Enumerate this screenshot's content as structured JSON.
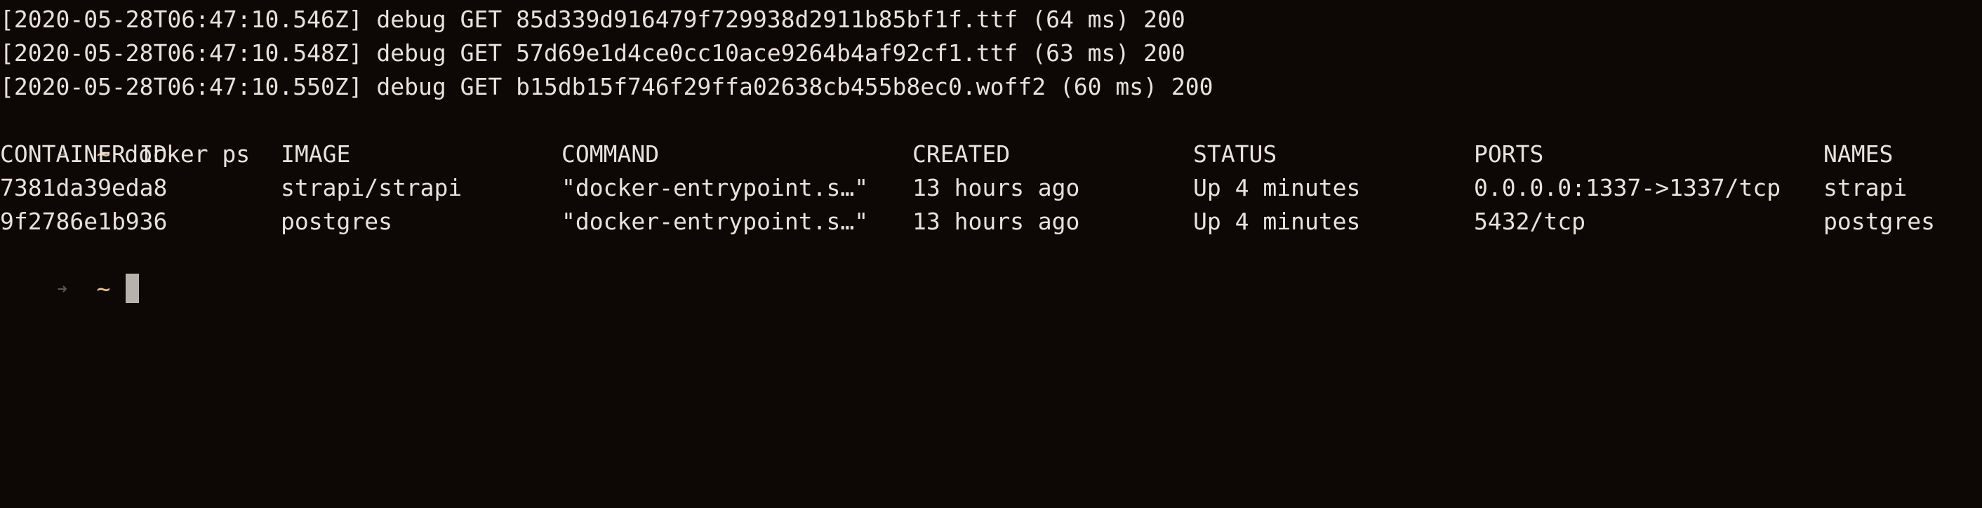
{
  "log_lines": [
    "[2020-05-28T06:47:10.546Z] debug GET 85d339d916479f729938d2911b85bf1f.ttf (64 ms) 200",
    "[2020-05-28T06:47:10.548Z] debug GET 57d69e1d4ce0cc10ace9264b4af92cf1.ttf (63 ms) 200",
    "[2020-05-28T06:47:10.550Z] debug GET b15db15f746f29ffa02638cb455b8ec0.woff2 (60 ms) 200"
  ],
  "prompt": {
    "arrow": "➜",
    "tilde": "~",
    "command": "docker ps"
  },
  "table": {
    "headers": {
      "container_id": "CONTAINER ID",
      "image": "IMAGE",
      "command": "COMMAND",
      "created": "CREATED",
      "status": "STATUS",
      "ports": "PORTS",
      "names": "NAMES"
    },
    "rows": [
      {
        "container_id": "7381da39eda8",
        "image": "strapi/strapi",
        "command": "\"docker-entrypoint.s…\"",
        "created": "13 hours ago",
        "status": "Up 4 minutes",
        "ports": "0.0.0.0:1337->1337/tcp",
        "names": "strapi"
      },
      {
        "container_id": "9f2786e1b936",
        "image": "postgres",
        "command": "\"docker-entrypoint.s…\"",
        "created": "13 hours ago",
        "status": "Up 4 minutes",
        "ports": "5432/tcp",
        "names": "postgres"
      }
    ]
  },
  "colors": {
    "background": "#0d0706",
    "text": "#e8e2dc",
    "prompt_tilde": "#e8c989",
    "prompt_arrow": "#5d5450",
    "cursor": "#b8b2ad"
  }
}
